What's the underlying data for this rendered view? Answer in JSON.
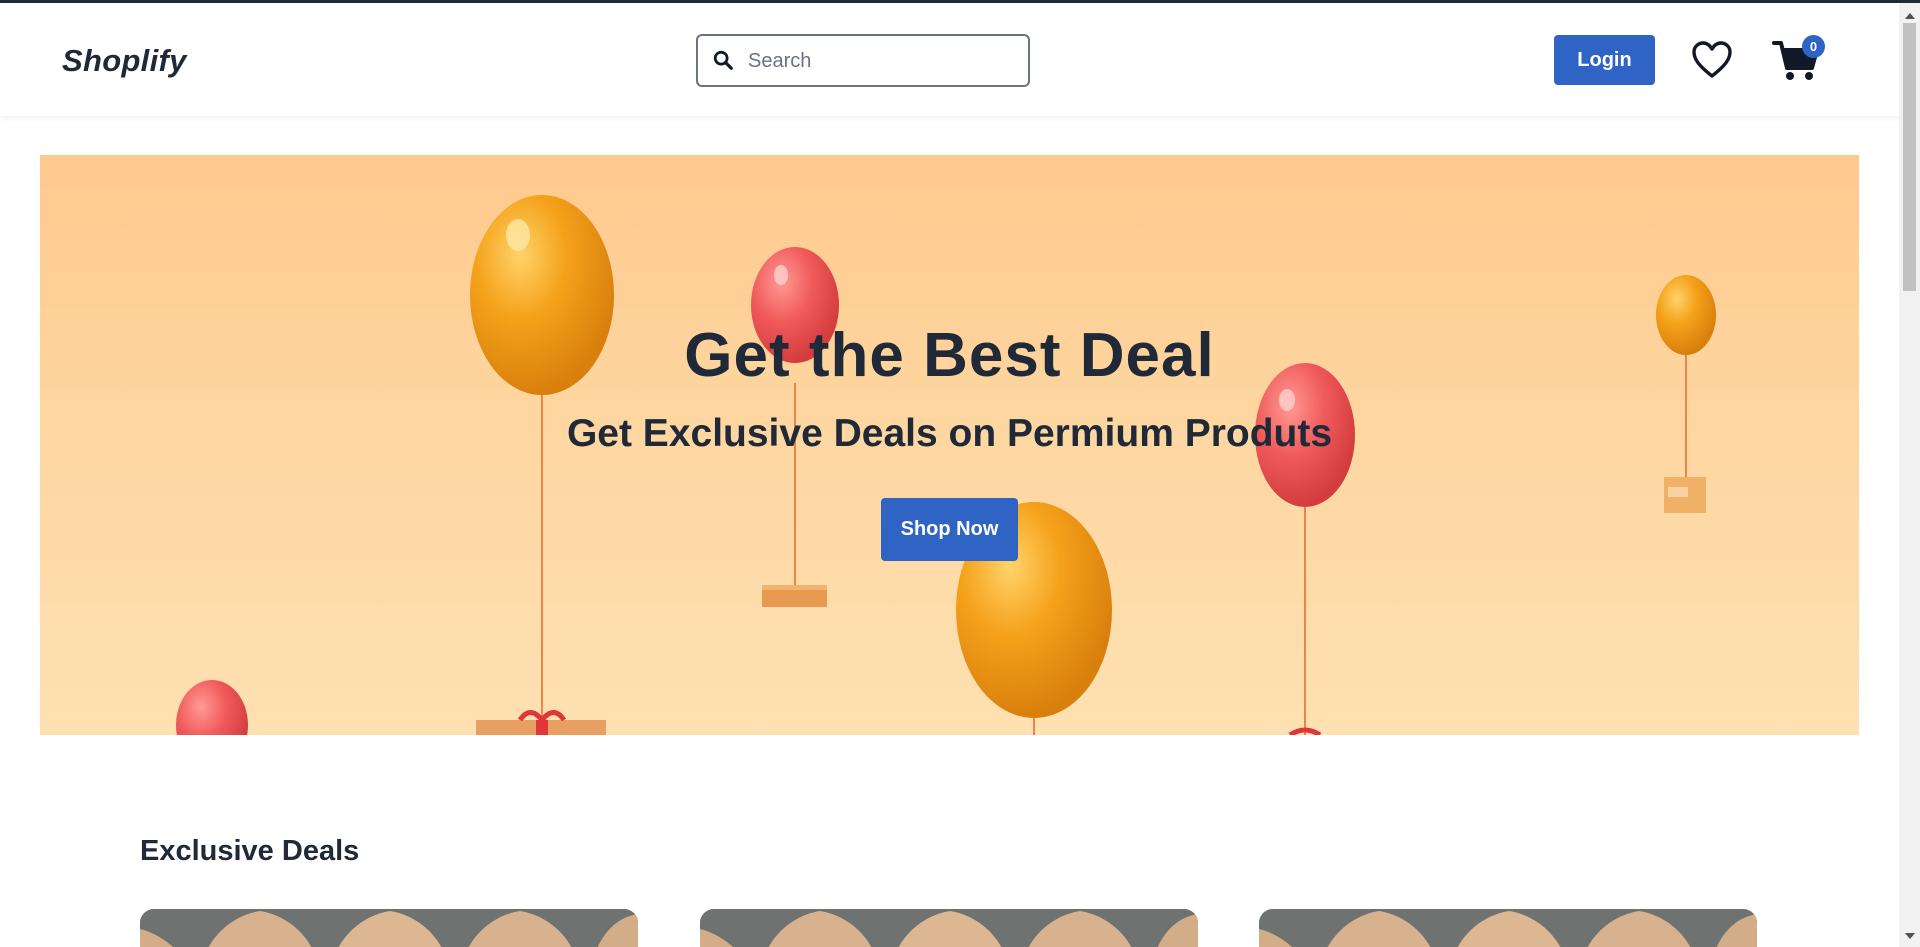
{
  "header": {
    "logo": "Shoplify",
    "search_placeholder": "Search",
    "search_value": "",
    "login_label": "Login",
    "cart_count": "0",
    "icons": [
      "search-icon",
      "heart-icon",
      "cart-icon"
    ]
  },
  "hero": {
    "title": "Get the Best Deal",
    "subtitle": "Get Exclusive Deals on Permium Produts",
    "cta_label": "Shop Now"
  },
  "deals": {
    "title": "Exclusive Deals",
    "cards": [
      "card-1",
      "card-2",
      "card-3"
    ]
  },
  "colors": {
    "primary": "#2f64c4",
    "text": "#1f2937",
    "hero_bg": "#fed6a0",
    "balloon_orange": "#f5a21b",
    "balloon_red": "#f05a5a"
  }
}
